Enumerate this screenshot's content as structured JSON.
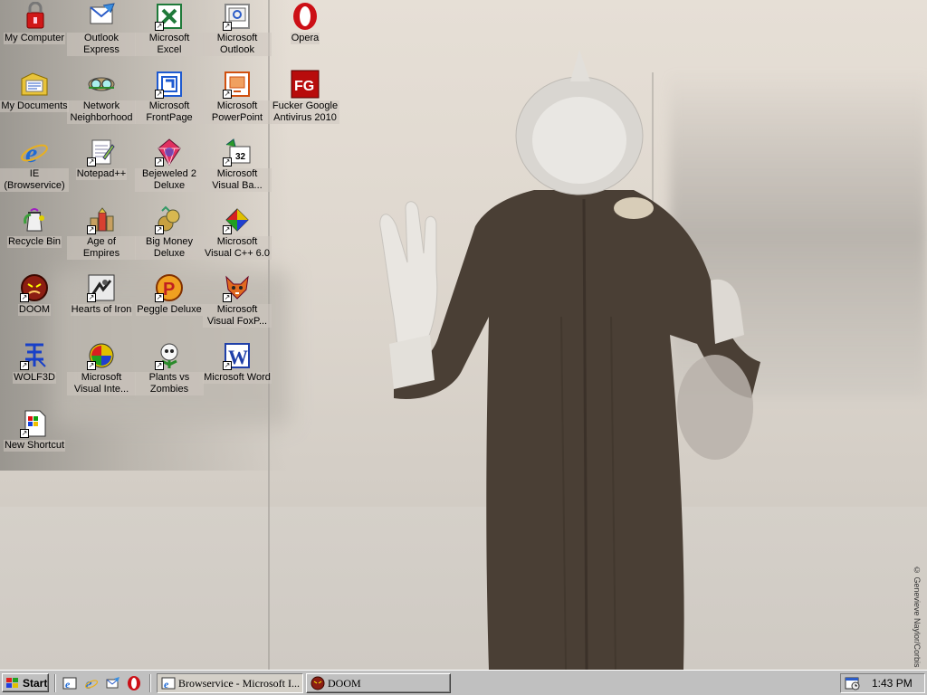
{
  "desktop": {
    "icons": [
      {
        "label": "My Computer",
        "glyph": "mycomputer-lock-icon"
      },
      {
        "label": "Outlook Express",
        "glyph": "outlook-express-icon"
      },
      {
        "label": "Microsoft Excel",
        "glyph": "excel-icon"
      },
      {
        "label": "Microsoft Outlook",
        "glyph": "outlook-icon"
      },
      {
        "label": "Opera",
        "glyph": "opera-icon"
      },
      {
        "label": "My Documents",
        "glyph": "my-documents-icon"
      },
      {
        "label": "Network Neighborhood",
        "glyph": "network-icon"
      },
      {
        "label": "Microsoft FrontPage",
        "glyph": "frontpage-icon"
      },
      {
        "label": "Microsoft PowerPoint",
        "glyph": "powerpoint-icon"
      },
      {
        "label": "Fucker Google Antivirus 2010",
        "glyph": "antivirus-icon",
        "badge": "FG"
      },
      {
        "label": "IE (Browservice)",
        "glyph": "ie-icon"
      },
      {
        "label": "Notepad++",
        "glyph": "notepad-icon"
      },
      {
        "label": "Bejeweled 2 Deluxe",
        "glyph": "bejeweled-icon"
      },
      {
        "label": "Microsoft Visual Ba...",
        "glyph": "visual-basic-icon",
        "badge": "32"
      },
      {
        "label": "Recycle Bin",
        "glyph": "recycle-bin-icon"
      },
      {
        "label": "Age of Empires",
        "glyph": "age-of-empires-icon"
      },
      {
        "label": "Big Money Deluxe",
        "glyph": "big-money-icon"
      },
      {
        "label": "Microsoft Visual C++ 6.0",
        "glyph": "visual-cpp-icon"
      },
      {
        "label": "DOOM",
        "glyph": "doom-icon"
      },
      {
        "label": "Hearts of Iron",
        "glyph": "hearts-of-iron-icon"
      },
      {
        "label": "Peggle Deluxe",
        "glyph": "peggle-icon"
      },
      {
        "label": "Microsoft Visual FoxP...",
        "glyph": "foxpro-icon"
      },
      {
        "label": "WOLF3D",
        "glyph": "wolf3d-icon"
      },
      {
        "label": "Microsoft Visual Inte...",
        "glyph": "visual-interdev-icon"
      },
      {
        "label": "Plants vs Zombies",
        "glyph": "plants-vs-zombies-icon"
      },
      {
        "label": "Microsoft Word",
        "glyph": "word-icon",
        "badge": "W"
      },
      {
        "label": "New Shortcut",
        "glyph": "new-shortcut-icon"
      }
    ],
    "wallpaper_credit": "© Genevieve Naylor/Corbis"
  },
  "taskbar": {
    "start_label": "Start",
    "quick_launch": [
      "ie-quicklaunch-icon",
      "ie-browser-icon",
      "outlook-express-quicklaunch-icon",
      "opera-quicklaunch-icon"
    ],
    "tasks": [
      {
        "label": "Browservice - Microsoft I...",
        "icon": "ie-icon",
        "active": true
      },
      {
        "label": "DOOM",
        "icon": "doom-icon",
        "active": false
      }
    ],
    "clock": "1:43 PM"
  },
  "colors": {
    "taskbar": "#c0c0c0",
    "opera_red": "#cc0f16",
    "word_blue": "#1f3fa8",
    "excel_green": "#1f7a3a"
  }
}
